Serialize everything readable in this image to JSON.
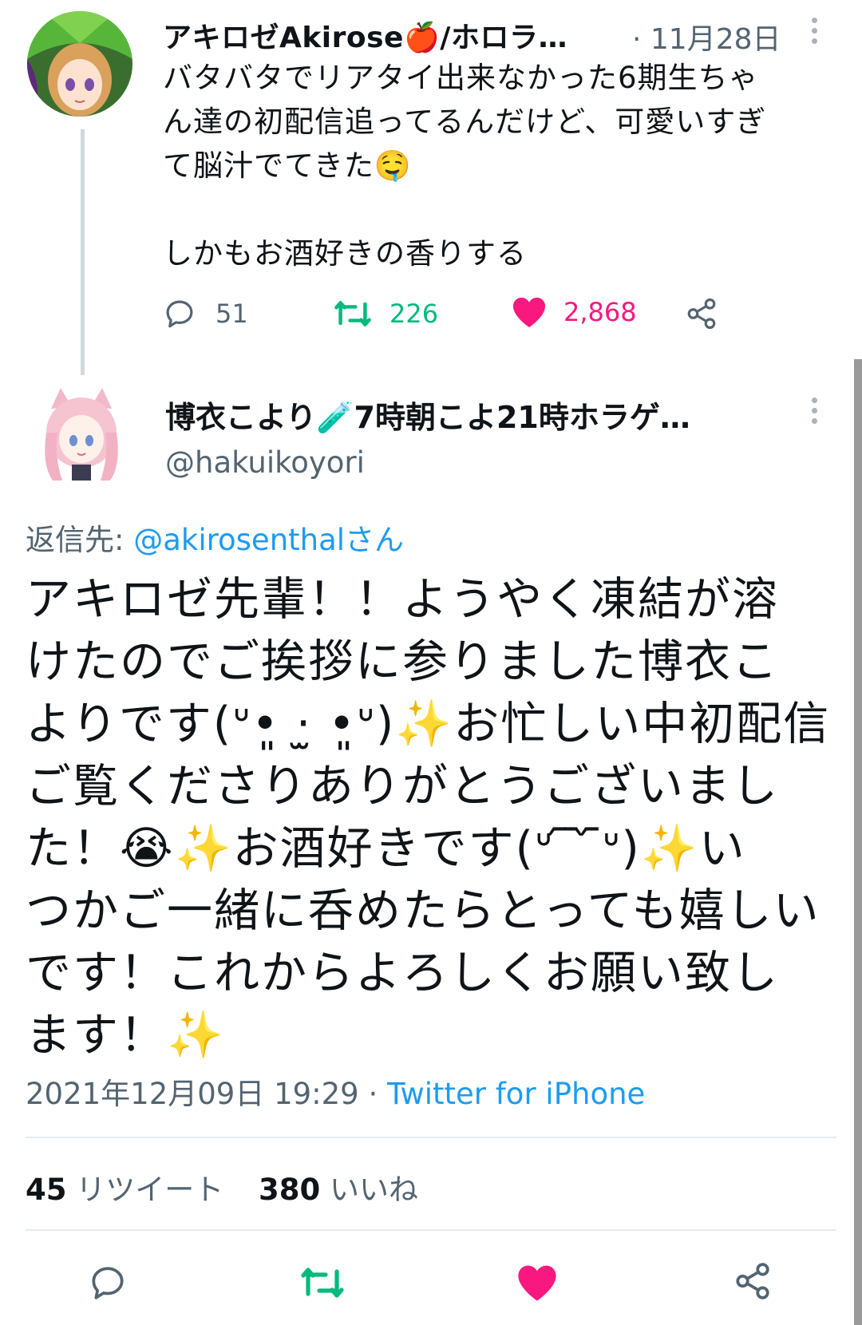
{
  "thread_tweet": {
    "display_name": "アキロゼAkirose🍎/ホロラ…",
    "date": "· 11月28日",
    "text_lines": [
      "バタバタでリアタイ出来なかった6期生ちゃ",
      "ん達の初配信追ってるんだけど、可愛いすぎ",
      "て脳汁でてきた🤤",
      "",
      "しかもお酒好きの香りする"
    ],
    "actions": {
      "reply_count": "51",
      "retweet_count": "226",
      "like_count": "2,868"
    }
  },
  "reply_tweet": {
    "display_name": "博衣こより🧪7時朝こよ21時ホラゲ…",
    "handle": "@hakuikoyori",
    "reply_prefix": "返信先: ",
    "reply_mention": "@akirosenthalさん",
    "text_lines": [
      "アキロゼ先輩！！ようやく凍結が溶",
      "けたのでご挨拶に参りました博衣こ",
      "よりです(ᐡ•͈ ·̫ •͈ᐡ)✨お忙しい中初配信",
      "ご覧くださりありがとうございまし",
      "た！😭✨お酒好きです(ᐡ ᷇ ᷆ ᷇ᐡ)✨い",
      "つかご一緒に呑めたらとっても嬉しい",
      "です！これからよろしくお願い致し",
      "ます！✨"
    ],
    "timestamp": "2021年12月09日 19:29",
    "separator": " · ",
    "source": "Twitter for iPhone",
    "retweets_count": "45",
    "retweets_label": "リツイート",
    "likes_count": "380",
    "likes_label": "いいね"
  },
  "colors": {
    "accent": "#1d9bf0",
    "retweet": "#00ba7c",
    "like": "#f91880",
    "secondary_text": "#536471"
  },
  "icons": [
    "reply-icon",
    "retweet-icon",
    "like-icon",
    "share-icon",
    "more-icon"
  ]
}
